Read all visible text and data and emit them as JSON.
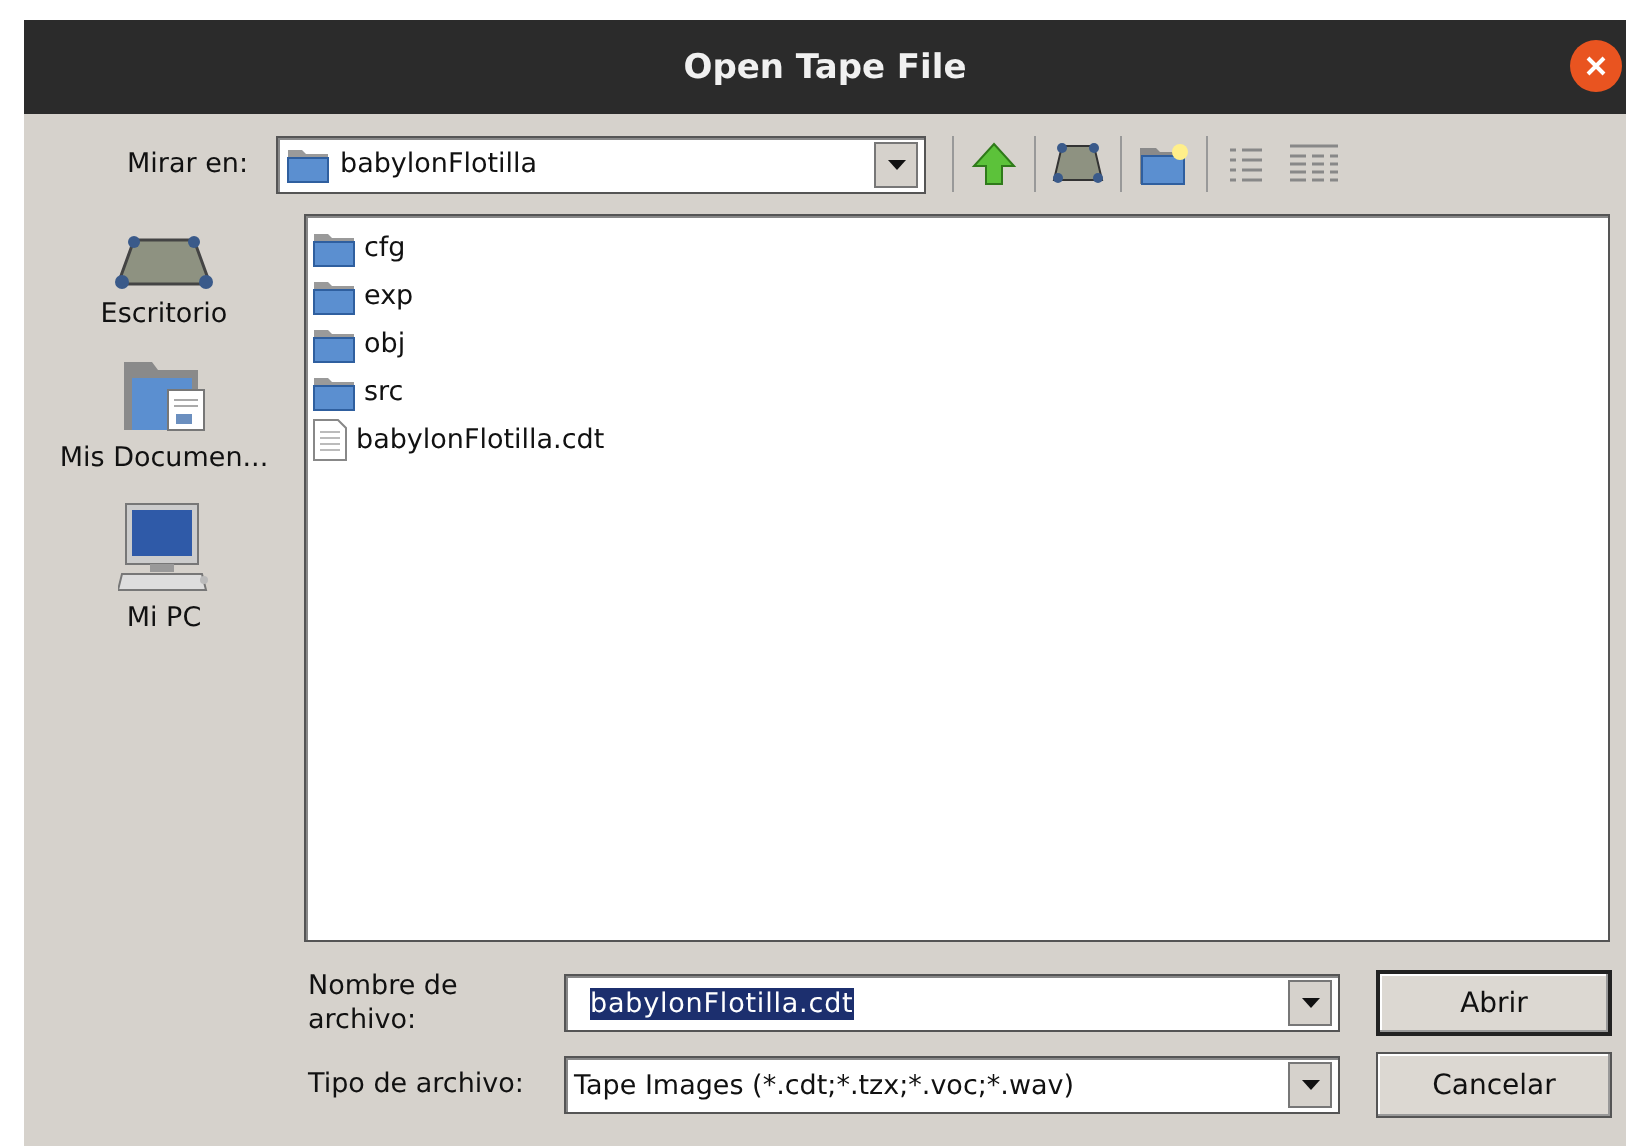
{
  "window": {
    "title": "Open Tape File"
  },
  "look_in": {
    "label": "Mirar en:",
    "value": "babylonFlotilla"
  },
  "sidebar": {
    "items": [
      {
        "label": "Escritorio",
        "kind": "desktop"
      },
      {
        "label": "Mis Documen...",
        "kind": "documents"
      },
      {
        "label": "Mi PC",
        "kind": "computer"
      }
    ]
  },
  "files": [
    {
      "name": "cfg",
      "kind": "folder"
    },
    {
      "name": "exp",
      "kind": "folder"
    },
    {
      "name": "obj",
      "kind": "folder"
    },
    {
      "name": "src",
      "kind": "folder"
    },
    {
      "name": "babylonFlotilla.cdt",
      "kind": "file"
    }
  ],
  "file_name": {
    "label": "Nombre de archivo:",
    "value": "babylonFlotilla.cdt",
    "text_selected": true
  },
  "file_type": {
    "label": "Tipo de archivo:",
    "value": "Tape Images (*.cdt;*.tzx;*.voc;*.wav)"
  },
  "buttons": [
    "Abrir",
    "Cancelar"
  ]
}
